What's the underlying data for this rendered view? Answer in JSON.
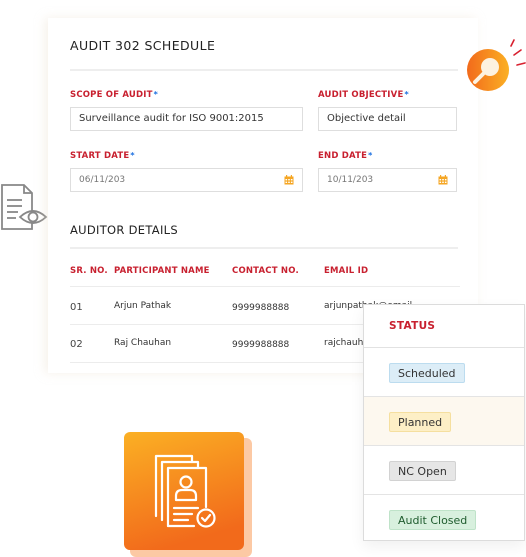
{
  "form": {
    "title": "AUDIT 302 SCHEDULE",
    "scope_label": "SCOPE OF AUDIT",
    "scope_value": "Surveillance audit for ISO 9001:2015",
    "objective_label": "AUDIT OBJECTIVE",
    "objective_value": "Objective detail",
    "start_label": "START DATE",
    "start_value": "06/11/203",
    "end_label": "END DATE",
    "end_value": "10/11/203",
    "required_mark": "*"
  },
  "auditors": {
    "title": "AUDITOR DETAILS",
    "columns": [
      "SR. NO.",
      "PARTICIPANT NAME",
      "CONTACT NO.",
      "EMAIL ID"
    ],
    "rows": [
      {
        "sr": "01",
        "name": "Arjun Pathak",
        "contact": "9999988888",
        "email": "arjunpathak@email"
      },
      {
        "sr": "02",
        "name": "Raj Chauhan",
        "contact": "9999988888",
        "email": "rajchauhan@email"
      }
    ]
  },
  "status": {
    "header": "STATUS",
    "items": [
      {
        "label": "Scheduled",
        "bg": "#dcedf7",
        "border": "#bcdcef",
        "color": "#333333"
      },
      {
        "label": "Planned",
        "bg": "#fdefc6",
        "border": "#f5df9f",
        "color": "#333333"
      },
      {
        "label": "NC Open",
        "bg": "#e6e6e6",
        "border": "#d2d2d2",
        "color": "#333333"
      },
      {
        "label": "Audit Closed",
        "bg": "#d8f0de",
        "border": "#bfe3c9",
        "color": "#1f5c2e"
      }
    ]
  },
  "colors": {
    "accent_red": "#c8202f",
    "accent_orange": "#f26a1b",
    "accent_yellow": "#fbb024",
    "required_blue": "#1a6fe0"
  }
}
